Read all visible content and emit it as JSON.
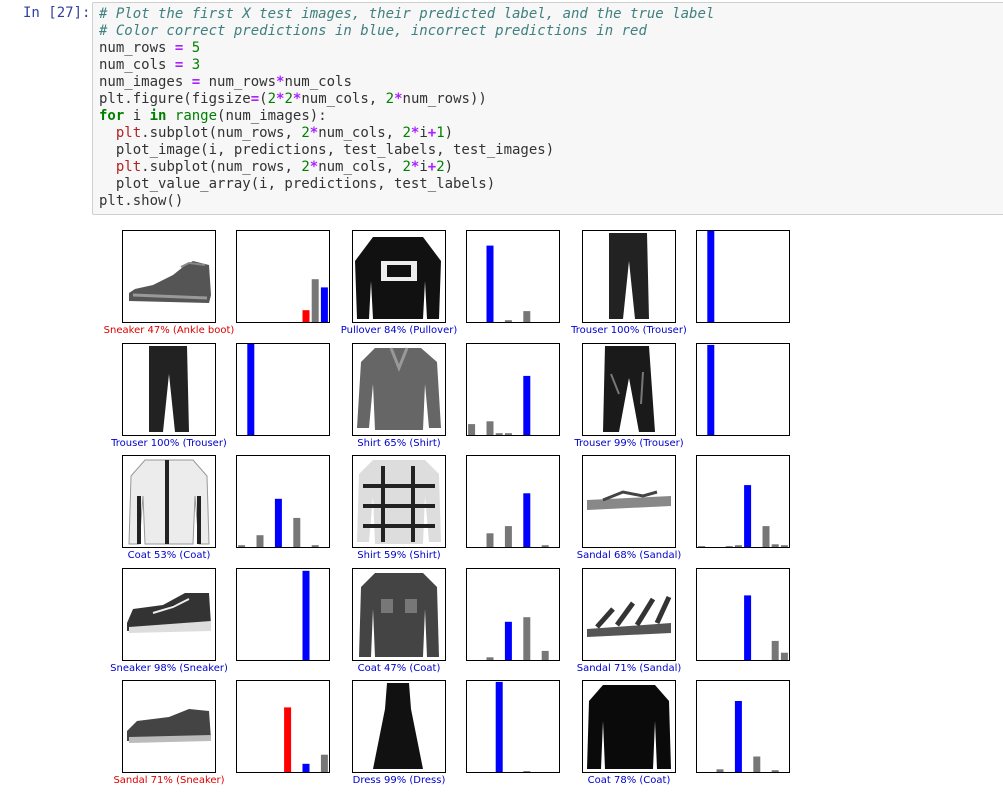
{
  "cell": {
    "prompt": "In [27]:",
    "code_lines": [
      [
        {
          "t": "# Plot the first X test images, their predicted label, and the true label",
          "c": "comment"
        }
      ],
      [
        {
          "t": "# Color correct predictions in blue, incorrect predictions in red",
          "c": "comment"
        }
      ],
      [
        {
          "t": "num_rows ",
          "c": ""
        },
        {
          "t": "=",
          "c": "op"
        },
        {
          "t": " ",
          "c": ""
        },
        {
          "t": "5",
          "c": "num"
        }
      ],
      [
        {
          "t": "num_cols ",
          "c": ""
        },
        {
          "t": "=",
          "c": "op"
        },
        {
          "t": " ",
          "c": ""
        },
        {
          "t": "3",
          "c": "num"
        }
      ],
      [
        {
          "t": "num_images ",
          "c": ""
        },
        {
          "t": "=",
          "c": "op"
        },
        {
          "t": " num_rows",
          "c": ""
        },
        {
          "t": "*",
          "c": "op"
        },
        {
          "t": "num_cols",
          "c": ""
        }
      ],
      [
        {
          "t": "plt.figure(figsize",
          "c": ""
        },
        {
          "t": "=",
          "c": "op"
        },
        {
          "t": "(",
          "c": ""
        },
        {
          "t": "2",
          "c": "num"
        },
        {
          "t": "*",
          "c": "op"
        },
        {
          "t": "2",
          "c": "num"
        },
        {
          "t": "*",
          "c": "op"
        },
        {
          "t": "num_cols, ",
          "c": ""
        },
        {
          "t": "2",
          "c": "num"
        },
        {
          "t": "*",
          "c": "op"
        },
        {
          "t": "num_rows))",
          "c": ""
        }
      ],
      [
        {
          "t": "for",
          "c": "kw"
        },
        {
          "t": " i ",
          "c": ""
        },
        {
          "t": "in",
          "c": "kw"
        },
        {
          "t": " ",
          "c": ""
        },
        {
          "t": "range",
          "c": "builtin"
        },
        {
          "t": "(num_images):",
          "c": ""
        }
      ],
      [
        {
          "t": "  ",
          "c": ""
        },
        {
          "t": "plt",
          "c": "red"
        },
        {
          "t": ".subplot(num_rows, ",
          "c": ""
        },
        {
          "t": "2",
          "c": "num"
        },
        {
          "t": "*",
          "c": "op"
        },
        {
          "t": "num_cols, ",
          "c": ""
        },
        {
          "t": "2",
          "c": "num"
        },
        {
          "t": "*",
          "c": "op"
        },
        {
          "t": "i",
          "c": ""
        },
        {
          "t": "+",
          "c": "op"
        },
        {
          "t": "1",
          "c": "num"
        },
        {
          "t": ")",
          "c": ""
        }
      ],
      [
        {
          "t": "  plot_image(i, predictions, test_labels, test_images)",
          "c": ""
        }
      ],
      [
        {
          "t": "  ",
          "c": ""
        },
        {
          "t": "plt",
          "c": "red"
        },
        {
          "t": ".subplot(num_rows, ",
          "c": ""
        },
        {
          "t": "2",
          "c": "num"
        },
        {
          "t": "*",
          "c": "op"
        },
        {
          "t": "num_cols, ",
          "c": ""
        },
        {
          "t": "2",
          "c": "num"
        },
        {
          "t": "*",
          "c": "op"
        },
        {
          "t": "i",
          "c": ""
        },
        {
          "t": "+",
          "c": "op"
        },
        {
          "t": "2",
          "c": "num"
        },
        {
          "t": ")",
          "c": ""
        }
      ],
      [
        {
          "t": "  plot_value_array(i, predictions, test_labels)",
          "c": ""
        }
      ],
      [
        {
          "t": "plt.show()",
          "c": ""
        }
      ]
    ]
  },
  "colors": {
    "correct": "#0000cc",
    "incorrect": "#dd0000",
    "bar_default": "#777777",
    "bar_correct": "#0000ff",
    "bar_incorrect": "#ff0000"
  },
  "plots": [
    {
      "caption": "Sneaker 47% (Ankle boot)",
      "correct": false,
      "item": "ankle-boot",
      "probs": [
        0,
        0,
        0,
        0,
        0,
        0,
        0,
        0.13,
        0.47,
        0.38
      ],
      "pred": 7,
      "true": 9
    },
    {
      "caption": "Pullover 84% (Pullover)",
      "correct": true,
      "item": "pullover",
      "probs": [
        0,
        0,
        0.84,
        0,
        0.02,
        0,
        0.12,
        0,
        0,
        0
      ],
      "pred": 2,
      "true": 2
    },
    {
      "caption": "Trouser 100% (Trouser)",
      "correct": true,
      "item": "trouser",
      "probs": [
        0,
        1.0,
        0,
        0,
        0,
        0,
        0,
        0,
        0,
        0
      ],
      "pred": 1,
      "true": 1
    },
    {
      "caption": "Trouser 100% (Trouser)",
      "correct": true,
      "item": "trouser",
      "probs": [
        0,
        1.0,
        0,
        0,
        0,
        0,
        0,
        0,
        0,
        0
      ],
      "pred": 1,
      "true": 1
    },
    {
      "caption": "Shirt 65% (Shirt)",
      "correct": true,
      "item": "shirt",
      "probs": [
        0.12,
        0,
        0.15,
        0.02,
        0.02,
        0,
        0.65,
        0,
        0,
        0
      ],
      "pred": 6,
      "true": 6
    },
    {
      "caption": "Trouser 99% (Trouser)",
      "correct": true,
      "item": "trouser-dark",
      "probs": [
        0,
        0.99,
        0,
        0,
        0,
        0,
        0,
        0,
        0,
        0
      ],
      "pred": 1,
      "true": 1
    },
    {
      "caption": "Coat 53% (Coat)",
      "correct": true,
      "item": "coat",
      "probs": [
        0.02,
        0,
        0.13,
        0,
        0.53,
        0,
        0.32,
        0,
        0.02,
        0
      ],
      "pred": 4,
      "true": 4
    },
    {
      "caption": "Shirt 59% (Shirt)",
      "correct": true,
      "item": "shirt-plaid",
      "probs": [
        0,
        0,
        0.15,
        0,
        0.23,
        0,
        0.59,
        0,
        0.02,
        0
      ],
      "pred": 6,
      "true": 6
    },
    {
      "caption": "Sandal 68% (Sandal)",
      "correct": true,
      "item": "sandal",
      "probs": [
        0.01,
        0,
        0,
        0.01,
        0.02,
        0.68,
        0,
        0.23,
        0.03,
        0.02
      ],
      "pred": 5,
      "true": 5
    },
    {
      "caption": "Sneaker 98% (Sneaker)",
      "correct": true,
      "item": "sneaker",
      "probs": [
        0,
        0,
        0,
        0,
        0,
        0,
        0,
        0.98,
        0,
        0
      ],
      "pred": 7,
      "true": 7
    },
    {
      "caption": "Coat 47% (Coat)",
      "correct": true,
      "item": "jacket",
      "probs": [
        0,
        0,
        0.03,
        0,
        0.42,
        0,
        0.47,
        0,
        0.1,
        0
      ],
      "pred": 4,
      "true": 4
    },
    {
      "caption": "Sandal 71% (Sandal)",
      "correct": true,
      "item": "sandal-strappy",
      "probs": [
        0,
        0,
        0,
        0,
        0,
        0.71,
        0,
        0,
        0.21,
        0.08
      ],
      "pred": 5,
      "true": 5
    },
    {
      "caption": "Sandal 71% (Sneaker)",
      "correct": false,
      "item": "sneaker-low",
      "probs": [
        0,
        0,
        0,
        0,
        0,
        0.71,
        0,
        0.09,
        0,
        0.19
      ],
      "pred": 5,
      "true": 7
    },
    {
      "caption": "Dress 99% (Dress)",
      "correct": true,
      "item": "dress",
      "probs": [
        0,
        0,
        0,
        0.99,
        0,
        0,
        0.01,
        0,
        0,
        0
      ],
      "pred": 3,
      "true": 3
    },
    {
      "caption": "Coat 78% (Coat)",
      "correct": true,
      "item": "coat-dark",
      "probs": [
        0,
        0,
        0.03,
        0,
        0.78,
        0,
        0.17,
        0,
        0.02,
        0
      ],
      "pred": 4,
      "true": 4
    }
  ]
}
